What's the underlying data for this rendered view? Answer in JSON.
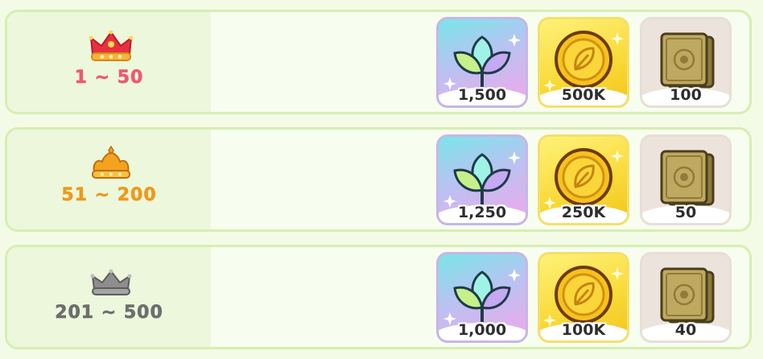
{
  "rewards": [
    {
      "range": "1 ~ 50",
      "range_color": "#f0596e",
      "crown": "red-crown-icon",
      "items": {
        "crystal": "1,500",
        "coins": "500K",
        "tickets": "100"
      }
    },
    {
      "range": "51 ~ 200",
      "range_color": "#ee9a1a",
      "crown": "gold-crown-icon",
      "items": {
        "crystal": "1,250",
        "coins": "250K",
        "tickets": "50"
      }
    },
    {
      "range": "201 ~ 500",
      "range_color": "#6e6e6e",
      "crown": "silver-crown-icon",
      "items": {
        "crystal": "1,000",
        "coins": "100K",
        "tickets": "40"
      }
    }
  ],
  "icons": {
    "crystal": "crystal-flower-icon",
    "coins": "gold-coin-icon",
    "tickets": "ticket-book-icon"
  }
}
